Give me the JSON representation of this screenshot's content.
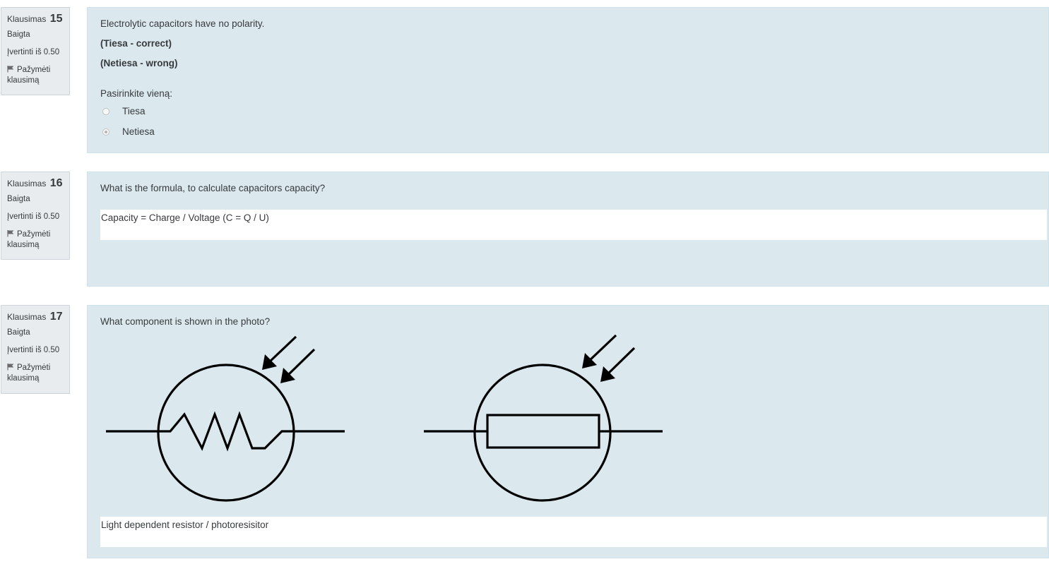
{
  "questions": [
    {
      "label": "Klausimas",
      "number": "15",
      "state": "Baigta",
      "grade": "Įvertinti iš 0.50",
      "flag_label": "Pažymėti klausimą",
      "text": "Electrolytic capacitors have no polarity.",
      "options_note": [
        "(Tiesa - correct)",
        "(Netiesa - wrong)"
      ],
      "prompt": "Pasirinkite vieną:",
      "options": [
        {
          "label": "Tiesa",
          "selected": false
        },
        {
          "label": "Netiesa",
          "selected": true
        }
      ]
    },
    {
      "label": "Klausimas",
      "number": "16",
      "state": "Baigta",
      "grade": "Įvertinti iš 0.50",
      "flag_label": "Pažymėti klausimą",
      "text": "What is the formula, to calculate capacitors capacity?",
      "answer": "Capacity = Charge / Voltage  (C = Q / U)"
    },
    {
      "label": "Klausimas",
      "number": "17",
      "state": "Baigta",
      "grade": "Įvertinti iš 0.50",
      "flag_label": "Pažymėti klausimą",
      "text": "What component is shown in the photo?",
      "image_symbols": [
        "ldr-zigzag-symbol",
        "ldr-rectangle-symbol"
      ],
      "answer": "Light dependent resistor / photoresisitor"
    }
  ],
  "icons": {
    "flag": "flag-icon"
  },
  "colors": {
    "content_bg": "#dbe9ef",
    "info_bg": "#e9ecef",
    "text": "#373a3c"
  }
}
